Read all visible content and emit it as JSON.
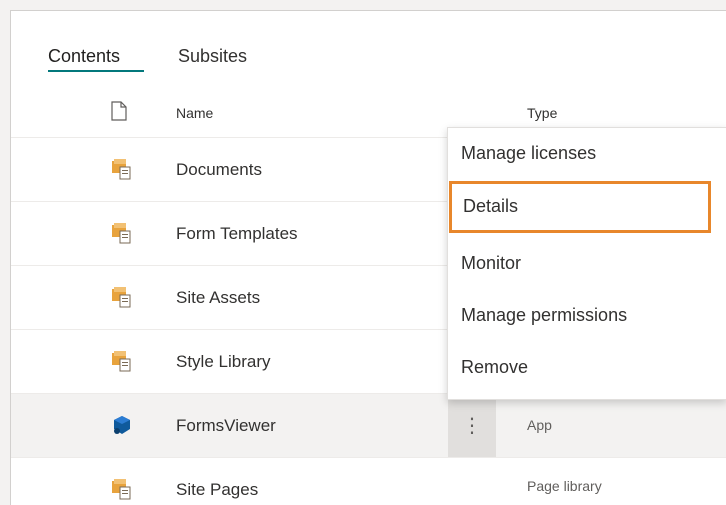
{
  "tabs": [
    {
      "label": "Contents",
      "active": true
    },
    {
      "label": "Subsites",
      "active": false
    }
  ],
  "table": {
    "columns": {
      "name": "Name",
      "type": "Type"
    },
    "rows": [
      {
        "name": "Documents",
        "type": "",
        "icon": "document-library-icon"
      },
      {
        "name": "Form Templates",
        "type": "",
        "icon": "document-library-icon"
      },
      {
        "name": "Site Assets",
        "type": "",
        "icon": "document-library-icon"
      },
      {
        "name": "Style Library",
        "type": "",
        "icon": "document-library-icon"
      },
      {
        "name": "FormsViewer",
        "type": "App",
        "icon": "app-icon",
        "selected": true
      },
      {
        "name": "Site Pages",
        "type": "Page library",
        "icon": "document-library-icon"
      }
    ]
  },
  "more_button_label": "⋮",
  "context_menu": {
    "items": [
      {
        "label": "Manage licenses"
      },
      {
        "label": "Details",
        "highlighted": true
      },
      {
        "label": "Monitor"
      },
      {
        "label": "Manage permissions"
      },
      {
        "label": "Remove"
      }
    ]
  },
  "colors": {
    "tab_underline": "#03787c",
    "highlight_border": "#e8872b",
    "folder_icon": "#e8a33d",
    "app_icon": "#0f5a9c"
  }
}
